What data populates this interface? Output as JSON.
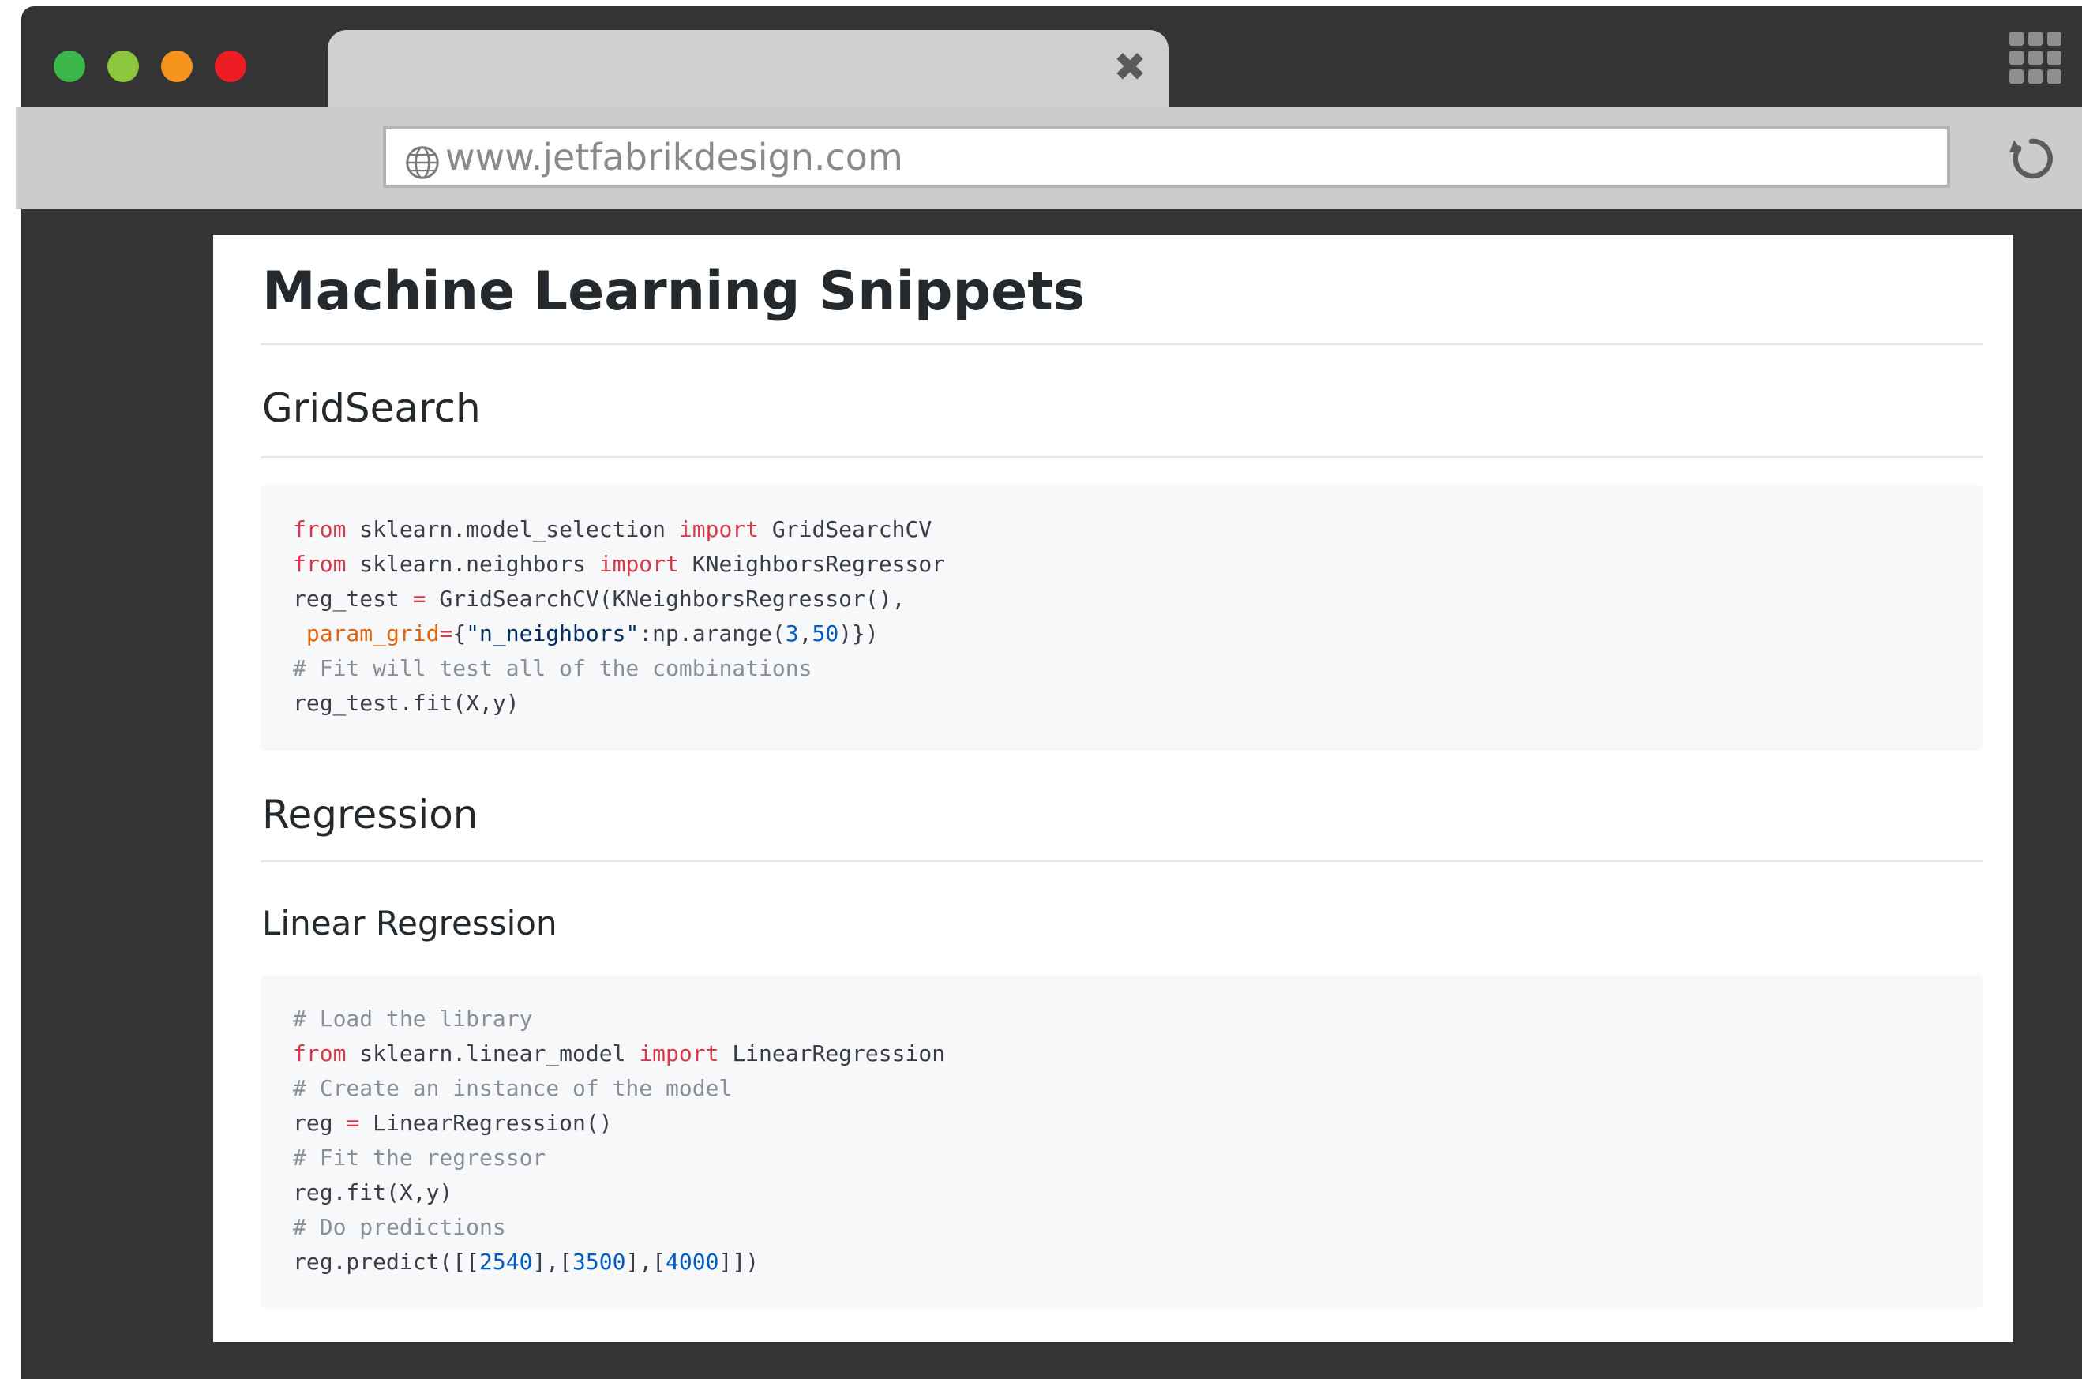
{
  "browser": {
    "traffic_lights": [
      {
        "name": "green",
        "color": "#3cb54a"
      },
      {
        "name": "lime",
        "color": "#8dc63f"
      },
      {
        "name": "orange",
        "color": "#f7941d"
      },
      {
        "name": "red",
        "color": "#ed1c24"
      }
    ],
    "tab": {
      "title": "",
      "close_icon": "close-icon"
    },
    "address": "www.jetfabrikdesign.com",
    "icons": {
      "globe": "globe-icon",
      "reload": "reload-icon",
      "apps": "apps-grid-icon"
    }
  },
  "page": {
    "title": "Machine Learning Snippets",
    "sections": {
      "gridsearch": {
        "heading": "GridSearch",
        "code": [
          [
            {
              "t": "from",
              "c": "kw"
            },
            {
              "t": " sklearn.model_selection "
            },
            {
              "t": "import",
              "c": "kw"
            },
            {
              "t": " GridSearchCV"
            }
          ],
          [
            {
              "t": "from",
              "c": "kw"
            },
            {
              "t": " sklearn.neighbors "
            },
            {
              "t": "import",
              "c": "kw"
            },
            {
              "t": " KNeighborsRegressor"
            }
          ],
          [
            {
              "t": "reg_test "
            },
            {
              "t": "=",
              "c": "op"
            },
            {
              "t": " GridSearchCV(KNeighborsRegressor(),"
            }
          ],
          [
            {
              "t": " "
            },
            {
              "t": "param_grid",
              "c": "par"
            },
            {
              "t": "=",
              "c": "op"
            },
            {
              "t": "{"
            },
            {
              "t": "\"n_neighbors\"",
              "c": "str"
            },
            {
              "t": ":np.arange("
            },
            {
              "t": "3",
              "c": "num"
            },
            {
              "t": ","
            },
            {
              "t": "50",
              "c": "num"
            },
            {
              "t": ")})"
            }
          ],
          [
            {
              "t": "# Fit will test all of the combinations",
              "c": "cm"
            }
          ],
          [
            {
              "t": "reg_test.fit(X,y)"
            }
          ]
        ]
      },
      "regression": {
        "heading": "Regression",
        "subheading": "Linear Regression",
        "code": [
          [
            {
              "t": "# Load the library",
              "c": "cm"
            }
          ],
          [
            {
              "t": "from",
              "c": "kw"
            },
            {
              "t": " sklearn.linear_model "
            },
            {
              "t": "import",
              "c": "kw"
            },
            {
              "t": " LinearRegression"
            }
          ],
          [
            {
              "t": "# Create an instance of the model",
              "c": "cm"
            }
          ],
          [
            {
              "t": "reg "
            },
            {
              "t": "=",
              "c": "op"
            },
            {
              "t": " LinearRegression()"
            }
          ],
          [
            {
              "t": "# Fit the regressor",
              "c": "cm"
            }
          ],
          [
            {
              "t": "reg.fit(X,y)"
            }
          ],
          [
            {
              "t": "# Do predictions",
              "c": "cm"
            }
          ],
          [
            {
              "t": "reg.predict([["
            },
            {
              "t": "2540",
              "c": "num"
            },
            {
              "t": "],["
            },
            {
              "t": "3500",
              "c": "num"
            },
            {
              "t": "],["
            },
            {
              "t": "4000",
              "c": "num"
            },
            {
              "t": "]])"
            }
          ]
        ]
      }
    }
  }
}
